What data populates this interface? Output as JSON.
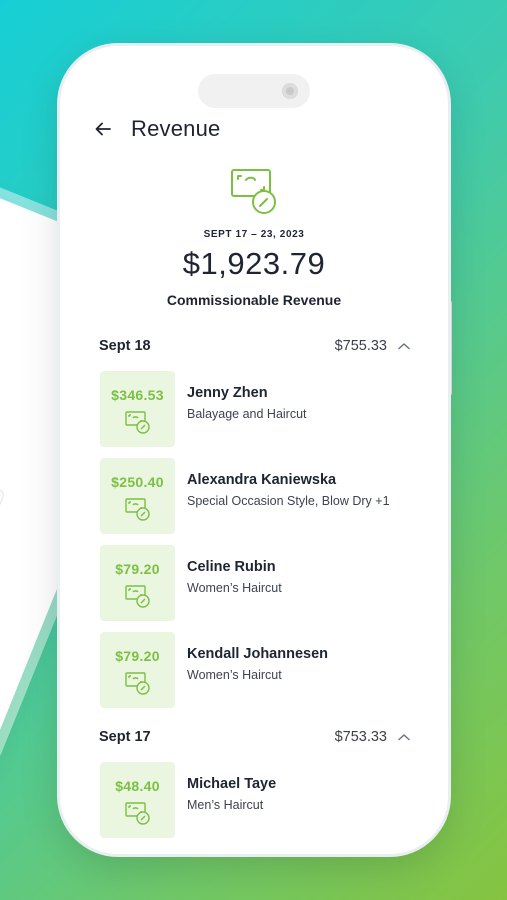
{
  "header": {
    "title": "Revenue"
  },
  "summary": {
    "date_range": "SEPT 17 – 23, 2023",
    "total": "$1,923.79",
    "total_label": "Commissionable Revenue"
  },
  "days": [
    {
      "label": "Sept 18",
      "total": "$755.33",
      "items": [
        {
          "amount": "$346.53",
          "name": "Jenny Zhen",
          "service": "Balayage and Haircut"
        },
        {
          "amount": "$250.40",
          "name": "Alexandra Kaniewska",
          "service": "Special Occasion Style, Blow Dry +1"
        },
        {
          "amount": "$79.20",
          "name": "Celine Rubin",
          "service": "Women’s Haircut"
        },
        {
          "amount": "$79.20",
          "name": "Kendall Johannesen",
          "service": "Women’s Haircut"
        }
      ]
    },
    {
      "label": "Sept 17",
      "total": "$753.33",
      "items": [
        {
          "amount": "$48.40",
          "name": "Michael Taye",
          "service": "Men’s Haircut"
        }
      ]
    }
  ],
  "colors": {
    "accent_green": "#7bc043",
    "tile_bg": "#eaf6df",
    "text_dark": "#1e2432"
  },
  "icons": [
    "arrow-left-icon",
    "cash-icon",
    "chevron-up-icon",
    "bell-icon"
  ]
}
